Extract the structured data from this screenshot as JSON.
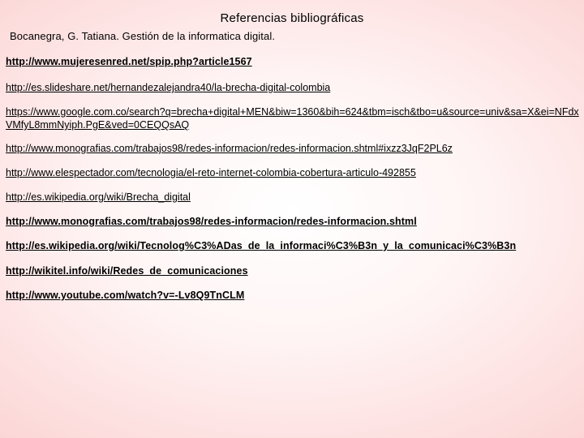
{
  "heading": {
    "title": "Referencias bibliográficas",
    "subtitle": "Bocanegra, G. Tatiana. Gestión de la informatica digital."
  },
  "references": [
    "http://www.mujeresenred.net/spip.php?article1567",
    "http://es.slideshare.net/hernandezalejandra40/la-brecha-digital-colombia",
    "https://www.google.com.co/search?q=brecha+digital+MEN&biw=1360&bih=624&tbm=isch&tbo=u&source=univ&sa=X&ei=NFdxVMfyL8mmNyiph.PgE&ved=0CEQQsAQ",
    "http://www.monografias.com/trabajos98/redes-informacion/redes-informacion.shtml#ixzz3JqF2PL6z",
    "http://www.elespectador.com/tecnologia/el-reto-internet-colombia-cobertura-articulo-492855",
    "http://es.wikipedia.org/wiki/Brecha_digital",
    "http://www.monografias.com/trabajos98/redes-informacion/redes-informacion.shtml",
    "http://es.wikipedia.org/wiki/Tecnolog%C3%ADas_de_la_informaci%C3%B3n_y_la_comunicaci%C3%B3n",
    "http://wikitel.info/wiki/Redes_de_comunicaciones",
    "http://www.youtube.com/watch?v=-Lv8Q9TnCLM"
  ]
}
